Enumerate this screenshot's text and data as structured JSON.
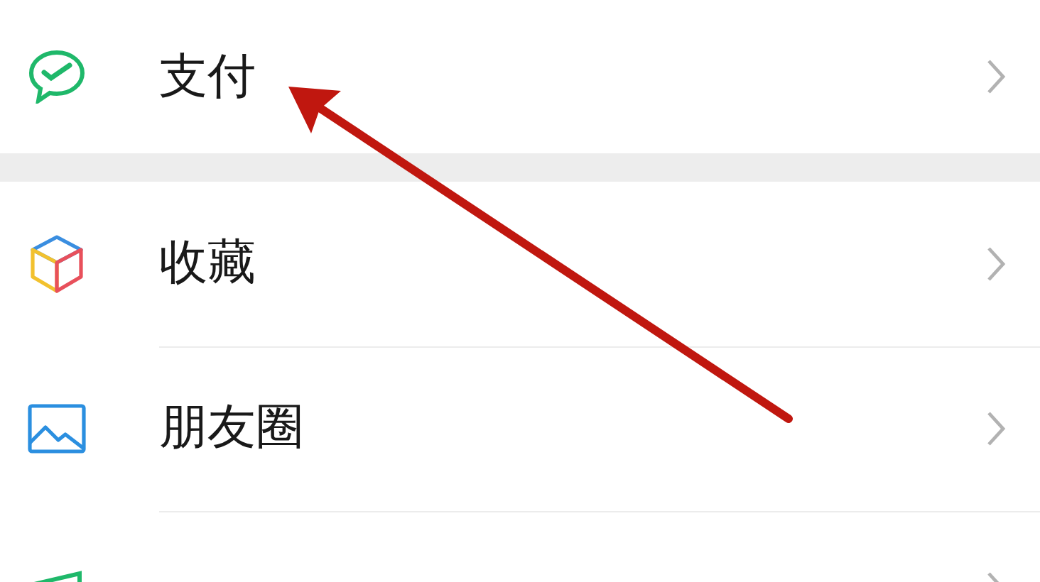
{
  "groups": [
    {
      "items": [
        {
          "kind": "pay",
          "label": "支付"
        }
      ]
    },
    {
      "items": [
        {
          "kind": "favorites",
          "label": "收藏"
        },
        {
          "kind": "moments",
          "label": "朋友圈"
        },
        {
          "kind": "cards"
        }
      ]
    }
  ]
}
